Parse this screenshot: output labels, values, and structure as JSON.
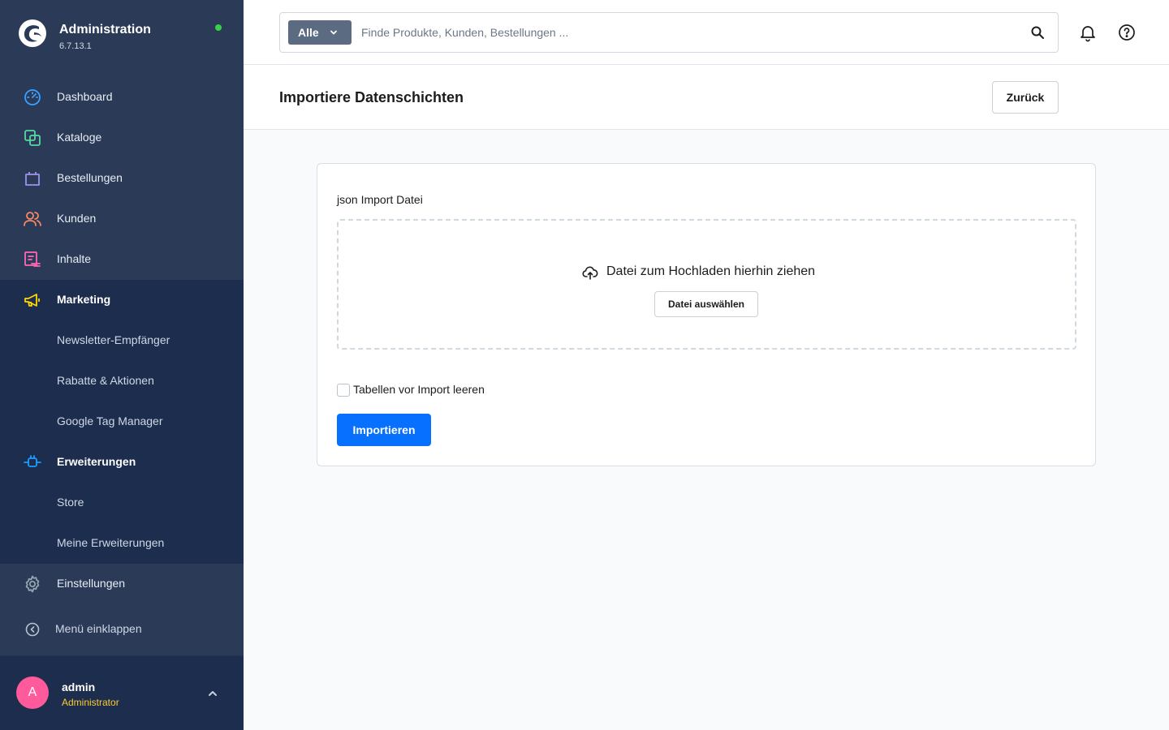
{
  "app": {
    "title": "Administration",
    "version": "6.7.13.1"
  },
  "sidebar": {
    "items": [
      {
        "label": "Dashboard",
        "icon": "dashboard-icon",
        "color": "#3aa1ff"
      },
      {
        "label": "Kataloge",
        "icon": "catalog-icon",
        "color": "#57d9a3"
      },
      {
        "label": "Bestellungen",
        "icon": "orders-bag-icon",
        "color": "#a092f0"
      },
      {
        "label": "Kunden",
        "icon": "customers-icon",
        "color": "#f88962"
      },
      {
        "label": "Inhalte",
        "icon": "content-icon",
        "color": "#ff68b4"
      },
      {
        "label": "Marketing",
        "icon": "megaphone-icon",
        "color": "#ffd700"
      },
      {
        "label": "Newsletter-Empfänger"
      },
      {
        "label": "Rabatte & Aktionen"
      },
      {
        "label": "Google Tag Manager"
      },
      {
        "label": "Erweiterungen",
        "icon": "extensions-plug-icon",
        "color": "#189eff"
      },
      {
        "label": "Store"
      },
      {
        "label": "Meine Erweiterungen"
      },
      {
        "label": "Einstellungen",
        "icon": "gear-icon",
        "color": "#9aa8b5"
      }
    ],
    "collapse_label": "Menü einklappen",
    "user": {
      "initial": "A",
      "name": "admin",
      "role": "Administrator"
    }
  },
  "search": {
    "type_label": "Alle",
    "placeholder": "Finde Produkte, Kunden, Bestellungen ..."
  },
  "page": {
    "title": "Importiere Datenschichten",
    "back_label": "Zurück"
  },
  "form": {
    "file_label": "json Import Datei",
    "drop_text": "Datei zum Hochladen hierhin ziehen",
    "pick_label": "Datei auswählen",
    "checkbox_label": "Tabellen vor Import leeren",
    "checkbox_checked": false,
    "import_label": "Importieren"
  },
  "colors": {
    "sidebar_bg": "#2a3a57",
    "sidebar_dark": "#1c2d4d",
    "primary": "#0870ff",
    "status_online": "#37d046",
    "avatar": "#ff5b9c",
    "role": "#ffcc33"
  }
}
